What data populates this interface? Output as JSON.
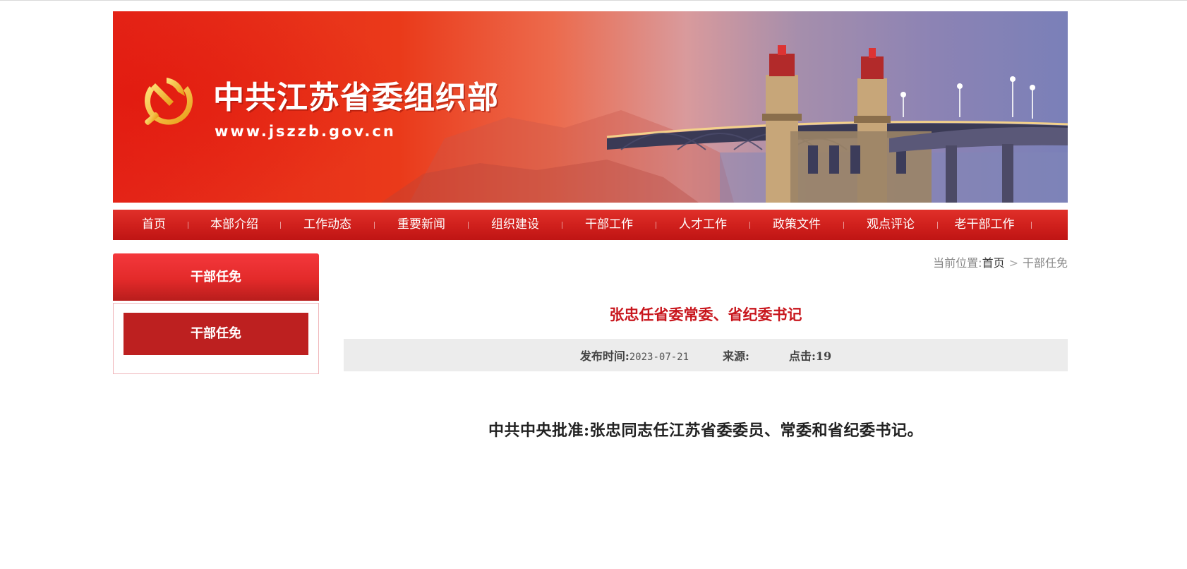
{
  "header": {
    "site_title": "中共江苏省委组织部",
    "site_url": "www.jszzb.gov.cn"
  },
  "nav": {
    "items": [
      {
        "label": "首页"
      },
      {
        "label": "本部介绍"
      },
      {
        "label": "工作动态"
      },
      {
        "label": "重要新闻"
      },
      {
        "label": "组织建设"
      },
      {
        "label": "干部工作"
      },
      {
        "label": "人才工作"
      },
      {
        "label": "政策文件"
      },
      {
        "label": "观点评论"
      },
      {
        "label": "老干部工作"
      }
    ]
  },
  "sidebar": {
    "heading": "干部任免",
    "items": [
      {
        "label": "干部任免"
      }
    ]
  },
  "breadcrumb": {
    "prefix": "当前位置:",
    "home": "首页",
    "separator": ">",
    "current": "干部任免"
  },
  "article": {
    "title": "张忠任省委常委、省纪委书记",
    "publish_label": "发布时间:",
    "publish_date": "2023-07-21",
    "source_label": "来源:",
    "source_value": "",
    "clicks_label": "点击:",
    "clicks_value": "19",
    "body": "中共中央批准:张忠同志任江苏省委委员、常委和省纪委书记。"
  },
  "colors": {
    "primary_red": "#c8161d",
    "nav_red": "#cf1f1c",
    "meta_bg": "#ececec"
  }
}
